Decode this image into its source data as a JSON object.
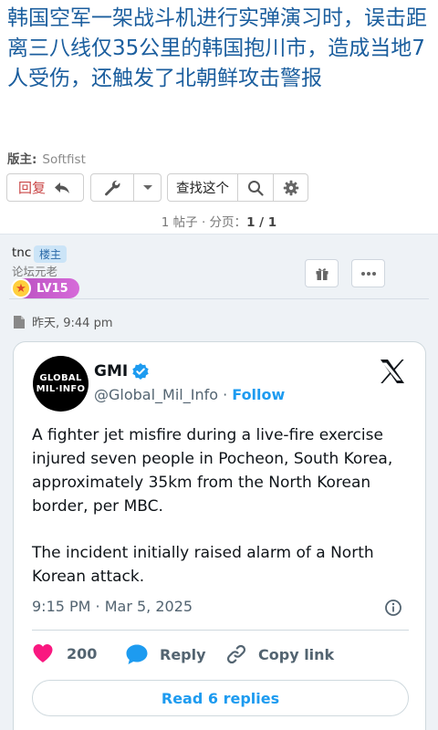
{
  "thread": {
    "title": "韩国空军一架战斗机进行实弹演习时，误击距离三八线仅35公里的韩国抱川市，造成当地7人受伤，还触发了北朝鲜攻击警报",
    "moderator_label": "版主:",
    "moderator_name": "Softfist"
  },
  "toolbar": {
    "reply_label": "回复",
    "search_label": "查找这个"
  },
  "pager": {
    "posts": "1 帖子 · 分页：",
    "page": "1 / 1"
  },
  "post": {
    "author": "tnc",
    "op_badge": "楼主",
    "user_title": "论坛元老",
    "level": "LV15",
    "time": "昨天, 9:44 pm"
  },
  "tweet": {
    "avatar_line1": "GLOBAL",
    "avatar_line2": "MIL·INFO",
    "name": "GMI",
    "handle": "@Global_Mil_Info",
    "separator": " · ",
    "follow": "Follow",
    "text_p1": "A fighter jet misfire during a live-fire exercise injured seven people in Pocheon, South Korea, approximately 35km from the North Korean border, per MBC.",
    "text_p2": "The incident initially raised alarm of a North Korean attack.",
    "date": "9:15 PM · Mar 5, 2025",
    "likes": "200",
    "reply_label": "Reply",
    "copy_label": "Copy link",
    "read_replies": "Read 6 replies"
  },
  "colors": {
    "title_link": "#1b5e9e",
    "reply_red": "#c94545",
    "twitter_blue": "#1d9bf0",
    "like_pink": "#f91880"
  }
}
